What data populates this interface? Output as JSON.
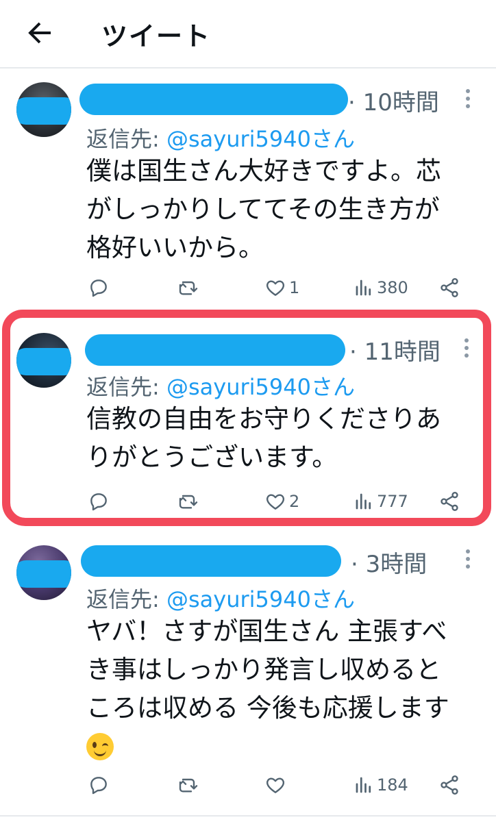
{
  "header": {
    "title": "ツイート"
  },
  "tweets": [
    {
      "time": "· 10時間",
      "reply_prefix": "返信先: ",
      "reply_handle": "@sayuri5940さん",
      "body_lines": [
        "僕は国生さん大好きですよ。芯",
        "がしっかりしててその生き方が",
        "格好いいから。"
      ],
      "likes": "1",
      "views": "380"
    },
    {
      "time": "· 11時間",
      "reply_prefix": "返信先: ",
      "reply_handle": "@sayuri5940さん",
      "body_lines": [
        "信教の自由をお守りくださりあ",
        "りがとうございます。"
      ],
      "likes": "2",
      "views": "777"
    },
    {
      "time": "· 3時間",
      "reply_prefix": "返信先: ",
      "reply_handle": "@sayuri5940さん",
      "body_lines": [
        "ヤバ！さすが国生さん 主張すべ",
        "き事はしっかり発言し収めると",
        "ころは収める 今後も応援します"
      ],
      "likes": "",
      "views": "184"
    }
  ],
  "colors": {
    "accent": "#1d9bf0",
    "highlight": "#f2495a",
    "redaction": "#19a9ef"
  }
}
